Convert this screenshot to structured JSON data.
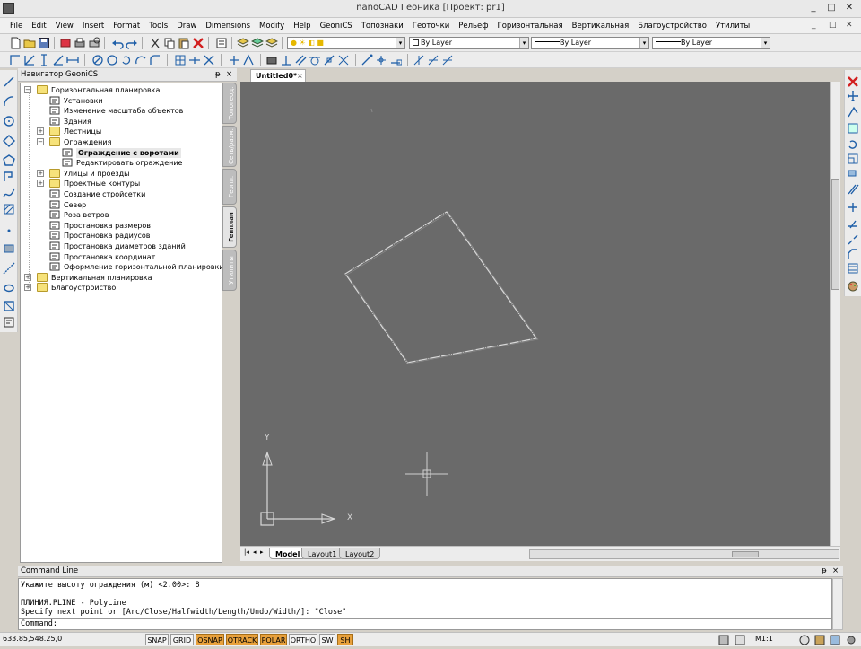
{
  "window": {
    "title": "nanoCAD Геоника [Проект: pr1]",
    "controls": [
      "_",
      "□",
      "✕"
    ]
  },
  "menu": {
    "items": [
      "File",
      "Edit",
      "View",
      "Insert",
      "Format",
      "Tools",
      "Draw",
      "Dimensions",
      "Modify",
      "Help",
      "GeoniCS",
      "Топознаки",
      "Геоточки",
      "Рельеф",
      "Горизонтальная",
      "Вертикальная",
      "Благоустройство",
      "Утилиты"
    ],
    "mdi_controls": [
      "_",
      "□",
      "✕"
    ]
  },
  "properties_toolbar": {
    "layer_value": "",
    "color_value": "By Layer",
    "linetype_value": "By Layer",
    "lineweight_value": "By Layer"
  },
  "navigator": {
    "title": "Навигатор GeoniCS",
    "pin": "ᵽ",
    "close": "×",
    "tree": [
      {
        "label": "Горизонтальная планировка",
        "depth": 0,
        "expander": "−",
        "icon": "folder"
      },
      {
        "label": "Установки",
        "depth": 1,
        "expander": "",
        "icon": "settings-icon"
      },
      {
        "label": "Изменение масштаба объектов",
        "depth": 1,
        "expander": "",
        "icon": "scale-icon"
      },
      {
        "label": "Здания",
        "depth": 1,
        "expander": "",
        "icon": "building-icon"
      },
      {
        "label": "Лестницы",
        "depth": 1,
        "expander": "+",
        "icon": "folder"
      },
      {
        "label": "Ограждения",
        "depth": 1,
        "expander": "−",
        "icon": "folder"
      },
      {
        "label": "Ограждение с воротами",
        "depth": 2,
        "expander": "",
        "icon": "fence-gate-icon",
        "selected": true
      },
      {
        "label": "Редактировать ограждение",
        "depth": 2,
        "expander": "",
        "icon": "fence-edit-icon"
      },
      {
        "label": "Улицы и проезды",
        "depth": 1,
        "expander": "+",
        "icon": "folder"
      },
      {
        "label": "Проектные контуры",
        "depth": 1,
        "expander": "+",
        "icon": "folder"
      },
      {
        "label": "Создание стройсетки",
        "depth": 1,
        "expander": "",
        "icon": "grid-icon"
      },
      {
        "label": "Север",
        "depth": 1,
        "expander": "",
        "icon": "north-icon"
      },
      {
        "label": "Роза ветров",
        "depth": 1,
        "expander": "",
        "icon": "wind-rose-icon"
      },
      {
        "label": "Простановка размеров",
        "depth": 1,
        "expander": "",
        "icon": "dimension-icon"
      },
      {
        "label": "Простановка радиусов",
        "depth": 1,
        "expander": "",
        "icon": "radius-icon"
      },
      {
        "label": "Простановка диаметров зданий",
        "depth": 1,
        "expander": "",
        "icon": "diameter-icon"
      },
      {
        "label": "Простановка координат",
        "depth": 1,
        "expander": "",
        "icon": "coordinate-icon"
      },
      {
        "label": "Оформление горизонтальной планировки",
        "depth": 1,
        "expander": "",
        "icon": "layout-icon"
      },
      {
        "label": "Вертикальная планировка",
        "depth": 0,
        "expander": "+",
        "icon": "folder"
      },
      {
        "label": "Благоустройство",
        "depth": 0,
        "expander": "+",
        "icon": "folder"
      }
    ],
    "vertical_tabs": [
      {
        "label": "Топогеод.",
        "active": false
      },
      {
        "label": "Сеть/разм.",
        "active": false
      },
      {
        "label": "Геопл.",
        "active": false
      },
      {
        "label": "Генплан",
        "active": true
      },
      {
        "label": "Утилиты",
        "active": false
      }
    ]
  },
  "document": {
    "tab_label": "Untitled0*",
    "close": "×"
  },
  "layout_tabs": {
    "nav": [
      "|◂",
      "◂",
      "▸",
      "▸|"
    ],
    "tabs": [
      "Model",
      "Layout1",
      "Layout2"
    ]
  },
  "ucs": {
    "x_label": "X",
    "y_label": "Y"
  },
  "command_line": {
    "title": "Command Line",
    "history": [
      "Укажите высоту ограждения (м) <2.00>: 8",
      "",
      "ПЛИНИЯ.PLINE - PolyLine",
      "Specify next point or [Arc/Close/Halfwidth/Length/Undo/Width/]: \"Close\""
    ],
    "prompt": "Command:"
  },
  "status": {
    "coordinates": "633.85,548.25,0",
    "buttons": [
      {
        "label": "SNAP",
        "on": false
      },
      {
        "label": "GRID",
        "on": false
      },
      {
        "label": "OSNAP",
        "on": true
      },
      {
        "label": "OTRACK",
        "on": true
      },
      {
        "label": "POLAR",
        "on": true
      },
      {
        "label": "ORTHO",
        "on": false
      },
      {
        "label": "SW",
        "on": false
      },
      {
        "label": "SH",
        "on": true
      }
    ],
    "scale": "M1:1"
  },
  "colors": {
    "drawing_bg": "#6a6a6a",
    "status_on": "#e8a13c",
    "folder": "#f6e27a"
  }
}
